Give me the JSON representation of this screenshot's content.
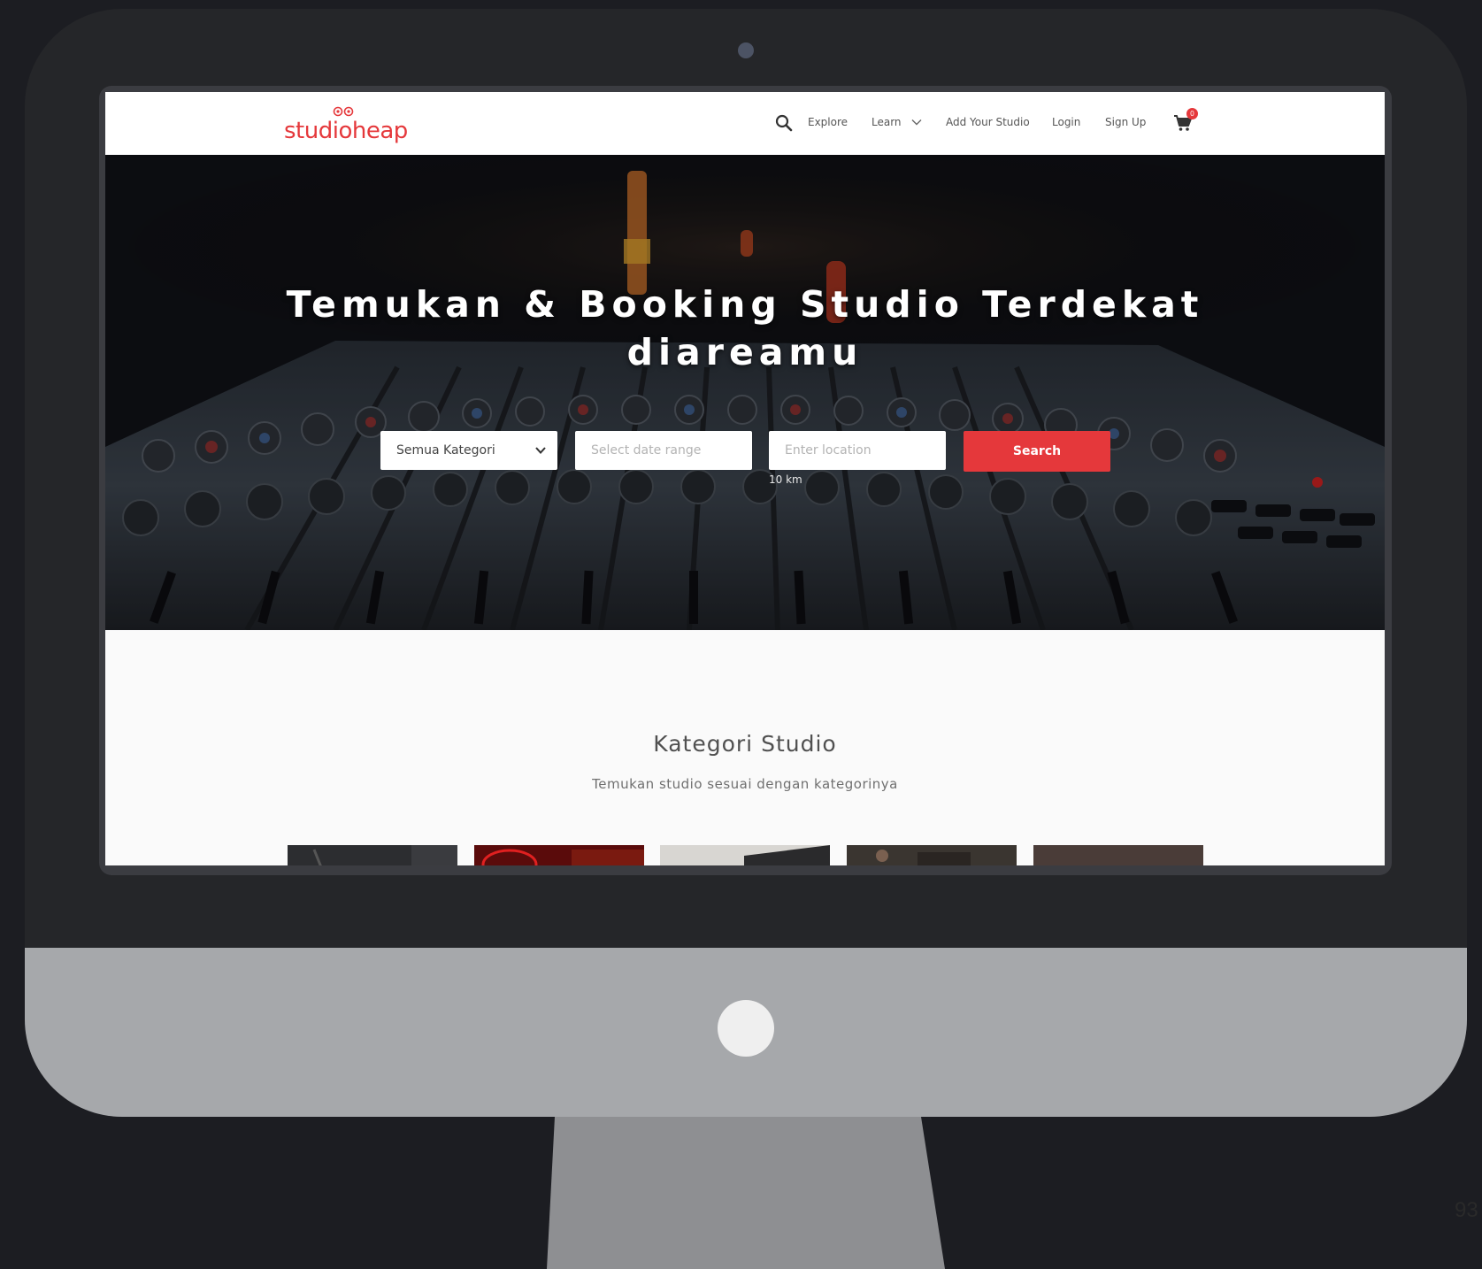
{
  "navbar": {
    "logo_text": "studioheap",
    "items": [
      {
        "label": "Explore"
      },
      {
        "label": "Learn"
      },
      {
        "label": "Add Your Studio"
      },
      {
        "label": "Login"
      },
      {
        "label": "Sign Up"
      }
    ],
    "cart_count": "0"
  },
  "hero": {
    "title_line1": "Temukan & Booking Studio Terdekat",
    "title_line2": "diareamu",
    "category_select": "Semua Kategori",
    "date_placeholder": "Select date range",
    "location_placeholder": "Enter location",
    "search_label": "Search",
    "radius_label": "10 km"
  },
  "category_section": {
    "title": "Kategori Studio",
    "subtitle": "Temukan studio sesuai dengan kategorinya"
  },
  "slide_number": "93",
  "colors": {
    "brand_red": "#e5383b",
    "device_frame": "#252629",
    "device_chin": "#a6a8ab",
    "page_background": "#1c1d22"
  }
}
